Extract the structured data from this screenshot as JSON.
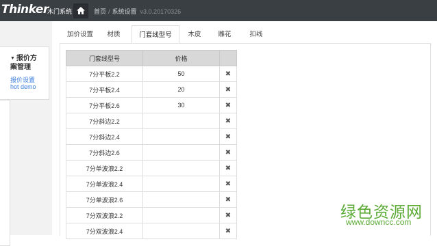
{
  "header": {
    "brand": "Thinker",
    "system_name": "木门系统",
    "breadcrumb": {
      "home": "首页",
      "separator": "/",
      "current": "系统设置",
      "version": "v3.0.20170326"
    }
  },
  "sidebar": {
    "group_line1": "报价方",
    "group_line2": "案管理",
    "items": [
      {
        "label": "报价设置"
      },
      {
        "label": "hot demo"
      }
    ]
  },
  "tabs": [
    {
      "label": "加价设置"
    },
    {
      "label": "材质"
    },
    {
      "label": "门套线型号",
      "active": true
    },
    {
      "label": "木皮"
    },
    {
      "label": "雕花"
    },
    {
      "label": "扣线"
    }
  ],
  "table": {
    "headers": [
      "门套线型号",
      "价格"
    ],
    "delete_symbol": "✖",
    "rows": [
      {
        "model": "7分平板2.2",
        "price": "50"
      },
      {
        "model": "7分平板2.4",
        "price": "20"
      },
      {
        "model": "7分平板2.6",
        "price": "30"
      },
      {
        "model": "7分斜边2.2",
        "price": ""
      },
      {
        "model": "7分斜边2.4",
        "price": ""
      },
      {
        "model": "7分斜边2.6",
        "price": ""
      },
      {
        "model": "7分单波浪2.2",
        "price": ""
      },
      {
        "model": "7分单波浪2.4",
        "price": ""
      },
      {
        "model": "7分单波浪2.6",
        "price": ""
      },
      {
        "model": "7分双波浪2.2",
        "price": ""
      },
      {
        "model": "7分双波浪2.4",
        "price": ""
      }
    ]
  },
  "watermark": {
    "line1": "绿色资源网",
    "line2": "www.downcc.com"
  },
  "colors": {
    "topbar": "#3a3f44",
    "link": "#3b7ddd",
    "header_cell": "#d8d8d8",
    "watermark": "#5aaa34"
  },
  "icons": {
    "home": "home-icon",
    "delete": "close-icon",
    "collapse": "caret-down-icon"
  }
}
